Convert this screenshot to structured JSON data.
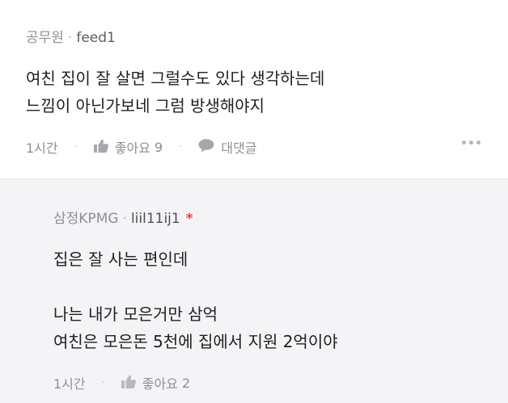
{
  "comment": {
    "author": "공무원",
    "separator": "·",
    "user_id": "feed1",
    "lines": [
      "여친 집이 잘 살면 그럴수도 있다 생각하는데",
      "느낌이 아닌가보네 그럼 방생해야지"
    ],
    "time": "1시간",
    "like_label": "좋아요",
    "like_count": "9",
    "reply_label": "대댓글",
    "action_sep": "·"
  },
  "reply": {
    "author": "삼정KPMG",
    "separator": "·",
    "user_id": "liil11ij1",
    "author_badge": "*",
    "lines": [
      "집은 잘 사는 편인데",
      "",
      "나는 내가 모은거만 삼억",
      "여친은 모은돈 5천에 집에서 지원 2억이야"
    ],
    "time": "1시간",
    "like_label": "좋아요",
    "like_count": "2",
    "action_sep": "·"
  },
  "icons": {
    "like": "thumbs-up-icon",
    "reply": "speech-bubble-icon",
    "more": "more-horizontal-icon"
  },
  "colors": {
    "reply_background": "#f4f4f6",
    "meta_text": "#8f8f95",
    "badge": "#f5394c"
  }
}
